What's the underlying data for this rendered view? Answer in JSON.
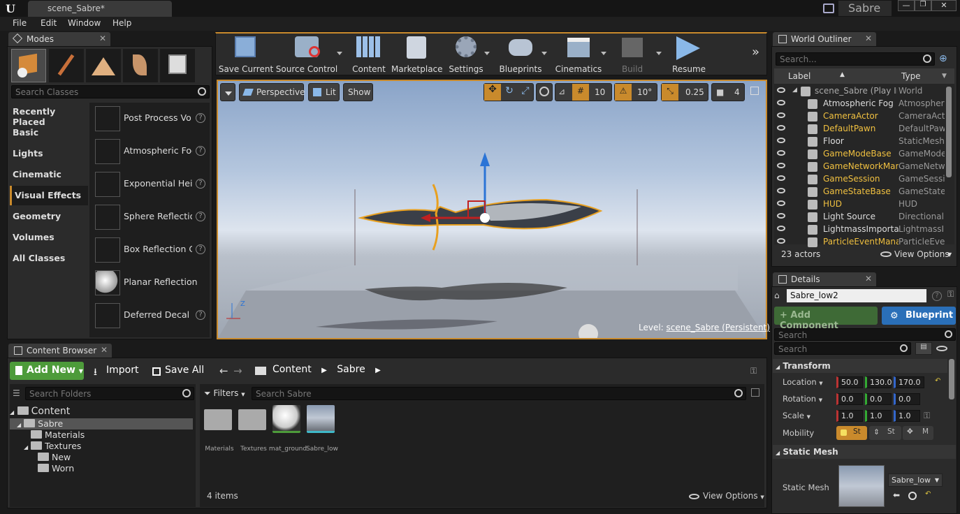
{
  "window": {
    "tab_title": "scene_Sabre*",
    "project_name": "Sabre"
  },
  "menu": [
    "File",
    "Edit",
    "Window",
    "Help"
  ],
  "toolbar": {
    "items": [
      {
        "label": "Save Current"
      },
      {
        "label": "Source Control"
      },
      {
        "label": "Content"
      },
      {
        "label": "Marketplace"
      },
      {
        "label": "Settings"
      },
      {
        "label": "Blueprints"
      },
      {
        "label": "Cinematics"
      },
      {
        "label": "Build"
      },
      {
        "label": "Resume"
      }
    ]
  },
  "modes": {
    "tab": "Modes",
    "search_placeholder": "Search Classes",
    "categories": [
      "Recently Placed",
      "Basic",
      "Lights",
      "Cinematic",
      "Visual Effects",
      "Geometry",
      "Volumes",
      "All Classes"
    ],
    "selected_category": "Visual Effects",
    "items": [
      "Post Process Vo",
      "Atmospheric Fog",
      "Exponential Heig",
      "Sphere Reflectio",
      "Box Reflection C",
      "Planar Reflection",
      "Deferred Decal"
    ]
  },
  "viewport": {
    "perspective": "Perspective",
    "lit": "Lit",
    "show": "Show",
    "grid_snap": "10",
    "rot_snap": "10°",
    "scale_snap": "0.25",
    "cam_speed": "4",
    "level_label": "Level:",
    "level_name": "scene_Sabre (Persistent)"
  },
  "outliner": {
    "tab": "World Outliner",
    "search_placeholder": "Search...",
    "col_label": "Label",
    "col_type": "Type",
    "root": {
      "label": "scene_Sabre (Play In E",
      "type": "World"
    },
    "rows": [
      {
        "label": "Atmospheric Fog",
        "type": "Atmospheric",
        "hl": false
      },
      {
        "label": "CameraActor",
        "type": "CameraActo",
        "hl": true
      },
      {
        "label": "DefaultPawn",
        "type": "DefaultPaw",
        "hl": true
      },
      {
        "label": "Floor",
        "type": "StaticMeshA",
        "hl": false
      },
      {
        "label": "GameModeBase",
        "type": "GameModeB",
        "hl": true
      },
      {
        "label": "GameNetworkManag",
        "type": "GameNetwo",
        "hl": true
      },
      {
        "label": "GameSession",
        "type": "GameSessic",
        "hl": true
      },
      {
        "label": "GameStateBase",
        "type": "GameStateB",
        "hl": true
      },
      {
        "label": "HUD",
        "type": "HUD",
        "hl": true
      },
      {
        "label": "Light Source",
        "type": "DirectionalL",
        "hl": false
      },
      {
        "label": "LightmassImportan",
        "type": "LightmassIr",
        "hl": false
      },
      {
        "label": "ParticleEventManag",
        "type": "ParticleEver",
        "hl": true
      }
    ],
    "actor_count": "23 actors",
    "view_options": "View Options"
  },
  "details": {
    "tab": "Details",
    "name_value": "Sabre_low2",
    "add_component": "+ Add Component",
    "blueprint": "Blueprint",
    "search_placeholder_1": "Search",
    "search_placeholder_2": "Search",
    "transform_header": "Transform",
    "location_label": "Location",
    "rotation_label": "Rotation",
    "scale_label": "Scale",
    "mobility_label": "Mobility",
    "location": [
      "50.0",
      "130.0",
      "170.0"
    ],
    "rotation": [
      "0.0",
      "0.0",
      "0.0"
    ],
    "scale": [
      "1.0",
      "1.0",
      "1.0"
    ],
    "mobility_options": [
      "St",
      "St",
      "M"
    ],
    "static_mesh_header": "Static Mesh",
    "static_mesh_label": "Static Mesh",
    "static_mesh_value": "Sabre_low"
  },
  "content_browser": {
    "tab": "Content Browser",
    "add_new": "Add New",
    "import": "Import",
    "save_all": "Save All",
    "path": [
      "Content",
      "Sabre"
    ],
    "search_folders_placeholder": "Search Folders",
    "filters": "Filters",
    "search_placeholder": "Search Sabre",
    "tree": [
      {
        "label": "Content",
        "level": 0
      },
      {
        "label": "Sabre",
        "level": 1
      },
      {
        "label": "Materials",
        "level": 2
      },
      {
        "label": "Textures",
        "level": 2
      },
      {
        "label": "New",
        "level": 3
      },
      {
        "label": "Worn",
        "level": 3
      }
    ],
    "assets": [
      "Materials",
      "Textures",
      "mat_ground",
      "Sabre_low"
    ],
    "item_count": "4 items",
    "view_options": "View Options"
  },
  "colors": {
    "accent_blue": "#2a6fb8",
    "add_green": "#4d9b3a",
    "selection_yellow": "#f0c040",
    "transform_orange": "#c98a2c"
  }
}
